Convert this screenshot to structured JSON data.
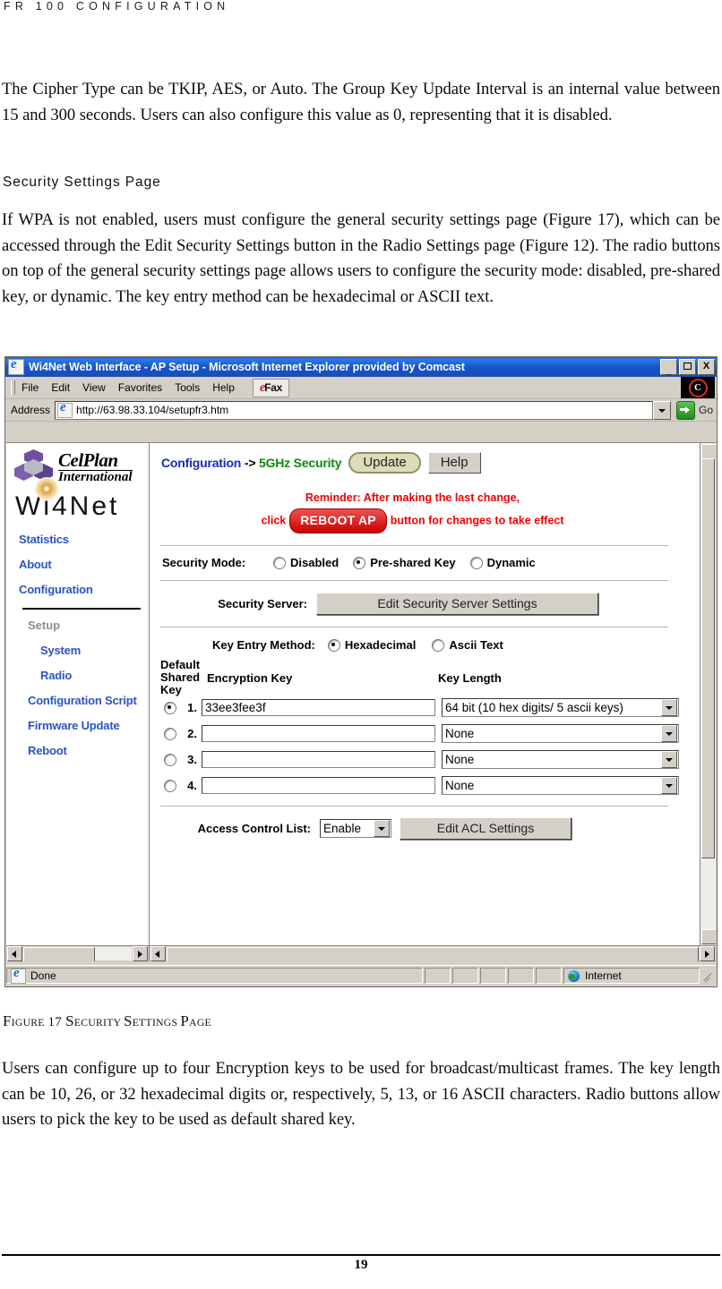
{
  "running_head": "FR 100 CONFIGURATION",
  "paragraphs": {
    "p1": "The Cipher Type can be TKIP, AES, or Auto. The Group Key Update Interval is an internal value between 15 and 300 seconds. Users can also configure this value as 0, representing that it is disabled.",
    "p2": "If WPA is not enabled, users must configure the general security settings page (Figure 17), which can be accessed through the Edit Security Settings button in the Radio Settings page (Figure 12). The radio buttons on top of the general security settings page allows users to configure the security mode: disabled, pre-shared key, or dynamic. The key entry method can be hexadecimal or ASCII text.",
    "p3": "Users can configure up to four Encryption keys to be used for broadcast/multicast frames. The key length can be 10, 26, or 32 hexadecimal digits or, respectively, 5, 13, or 16 ASCII characters. Radio buttons allow users to pick the key to be used as default shared key."
  },
  "section_heading": "Security Settings Page",
  "figure_caption": {
    "prefix_big": "F",
    "prefix_rest": "IGURE",
    "number": "17 ",
    "title_big_1": "S",
    "title_rest_1": "ECURITY ",
    "title_big_2": "S",
    "title_rest_2": "ETTINGS ",
    "title_big_3": "P",
    "title_rest_3": "AGE",
    "full": "FIGURE 17 SECURITY SETTINGS PAGE"
  },
  "page_number": "19",
  "browser": {
    "title": "Wi4Net Web Interface - AP Setup - Microsoft Internet Explorer provided by Comcast",
    "window_buttons": {
      "minimize": "_",
      "maximize": "",
      "close": "X"
    },
    "menu": [
      "File",
      "Edit",
      "View",
      "Favorites",
      "Tools",
      "Help"
    ],
    "efax_button": {
      "e": "e",
      "fax": "Fax"
    },
    "comcast_badge": "C",
    "address": {
      "label": "Address",
      "url": "http://63.98.33.104/setupfr3.htm",
      "go_label": "Go"
    },
    "status": {
      "done": "Done",
      "zone": "Internet"
    }
  },
  "sidebar": {
    "logo": {
      "celplan_line1": "CelPlan",
      "celplan_line2": "International",
      "wi4net_pre": "W",
      "wi4net_i": "i",
      "wi4net_post": "4Net"
    },
    "items": [
      {
        "label": "Statistics"
      },
      {
        "label": "About"
      },
      {
        "label": "Configuration"
      }
    ],
    "setup_title": "Setup",
    "setup_items": [
      {
        "label": "System"
      },
      {
        "label": "Radio"
      },
      {
        "label": "Configuration Script"
      },
      {
        "label": "Firmware Update"
      },
      {
        "label": "Reboot"
      }
    ]
  },
  "page": {
    "breadcrumb": {
      "root": "Configuration",
      "sep": " -> ",
      "current": "5GHz Security"
    },
    "update_button": "Update",
    "help_button": "Help",
    "reminder": {
      "line1": "Reminder: After making the last change,",
      "click": "click",
      "reboot_pill": "REBOOT AP",
      "line2_tail": "button for changes to take effect"
    },
    "security_mode": {
      "label": "Security Mode:",
      "options": [
        {
          "label": "Disabled",
          "checked": false
        },
        {
          "label": "Pre-shared Key",
          "checked": true
        },
        {
          "label": "Dynamic",
          "checked": false
        }
      ]
    },
    "security_server": {
      "label": "Security Server:",
      "button": "Edit Security Server Settings"
    },
    "key_entry_method": {
      "label": "Key Entry Method:",
      "options": [
        {
          "label": "Hexadecimal",
          "checked": true
        },
        {
          "label": "Ascii Text",
          "checked": false
        }
      ]
    },
    "key_table": {
      "headers": {
        "default_shared_key": "Default Shared Key",
        "default_shared_key_l1": "Default",
        "default_shared_key_l2": "Shared",
        "default_shared_key_l3": "Key",
        "encryption_key": "Encryption Key",
        "key_length": "Key Length"
      },
      "rows": [
        {
          "num": "1.",
          "selected": true,
          "key": "33ee3fee3f",
          "length": "64 bit (10 hex digits/ 5 ascii keys)"
        },
        {
          "num": "2.",
          "selected": false,
          "key": "",
          "length": "None"
        },
        {
          "num": "3.",
          "selected": false,
          "key": "",
          "length": "None"
        },
        {
          "num": "4.",
          "selected": false,
          "key": "",
          "length": "None"
        }
      ]
    },
    "acl": {
      "label": "Access Control List:",
      "select_value": "Enable",
      "button": "Edit ACL Settings"
    }
  }
}
